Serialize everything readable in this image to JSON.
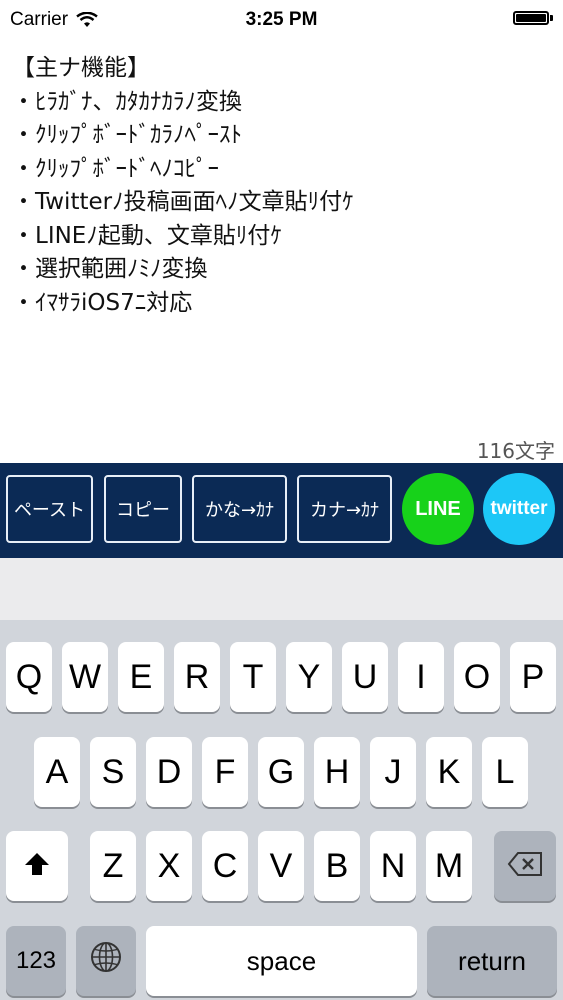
{
  "status_bar": {
    "carrier": "Carrier",
    "time": "3:25 PM"
  },
  "editor": {
    "lines": [
      "【主ナ機能】",
      "・ﾋﾗｶﾞﾅ、ｶﾀｶﾅｶﾗﾉ変換",
      "・ｸﾘｯﾌﾟﾎﾞｰﾄﾞｶﾗﾉﾍﾟｰｽﾄ",
      "・ｸﾘｯﾌﾟﾎﾞｰﾄﾞﾍﾉｺﾋﾟｰ",
      "・Twitterﾉ投稿画面ﾍﾉ文章貼ﾘ付ｹ",
      "・LINEﾉ起動、文章貼ﾘ付ｹ",
      "・選択範囲ﾉﾐﾉ変換",
      "・ｲﾏｻﾗiOS7ﾆ対応"
    ],
    "char_count": "116文字"
  },
  "toolbar": {
    "paste": "ペースト",
    "copy": "コピー",
    "kana_to_kata": "かな→ｶﾅ",
    "kata_to_half": "カナ→ｶﾅ",
    "line": "LINE",
    "twitter": "twitter"
  },
  "colors": {
    "toolbar_bg": "#0b2a55",
    "line_green": "#17d21a",
    "twitter_blue": "#1dc7f7"
  },
  "keyboard": {
    "row1": [
      "Q",
      "W",
      "E",
      "R",
      "T",
      "Y",
      "U",
      "I",
      "O",
      "P"
    ],
    "row2": [
      "A",
      "S",
      "D",
      "F",
      "G",
      "H",
      "J",
      "K",
      "L"
    ],
    "row3": [
      "Z",
      "X",
      "C",
      "V",
      "B",
      "N",
      "M"
    ],
    "numbers": "123",
    "space": "space",
    "return": "return",
    "icons": {
      "shift": "shift-icon",
      "backspace": "backspace-icon",
      "globe": "globe-icon"
    }
  }
}
